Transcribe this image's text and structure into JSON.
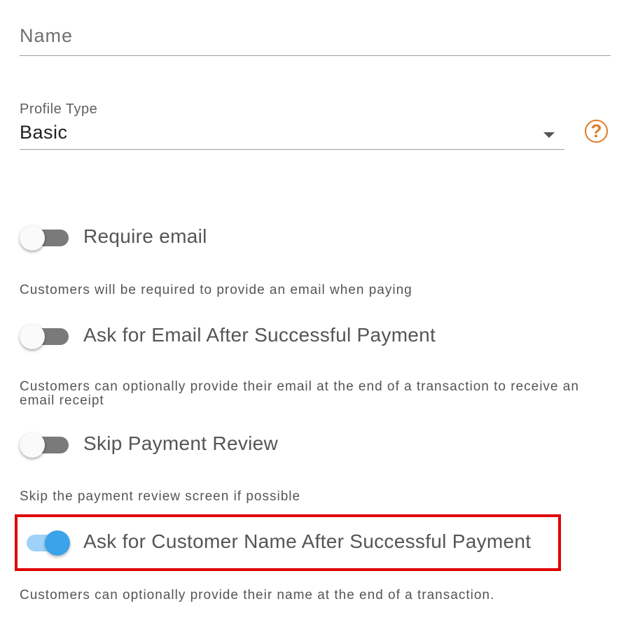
{
  "name_field": {
    "placeholder": "Name",
    "value": ""
  },
  "profile_type": {
    "label": "Profile Type",
    "selected": "Basic",
    "help_icon": "question-circle-icon",
    "help_symbol": "?"
  },
  "toggles": [
    {
      "label": "Require email",
      "checked": false,
      "description": "Customers will be required to provide an email when paying"
    },
    {
      "label": "Ask for Email After Successful Payment",
      "checked": false,
      "description": "Customers can optionally provide their email at the end of a transaction to receive an email receipt"
    },
    {
      "label": "Skip Payment Review",
      "checked": false,
      "description": "Skip the payment review screen if possible"
    },
    {
      "label": "Ask for Customer Name After Successful Payment",
      "checked": true,
      "description": "Customers can optionally provide their name at the end of a transaction."
    }
  ],
  "colors": {
    "accent": "#3aa3ea",
    "help_icon": "#e07b24",
    "highlight": "#e00000"
  }
}
